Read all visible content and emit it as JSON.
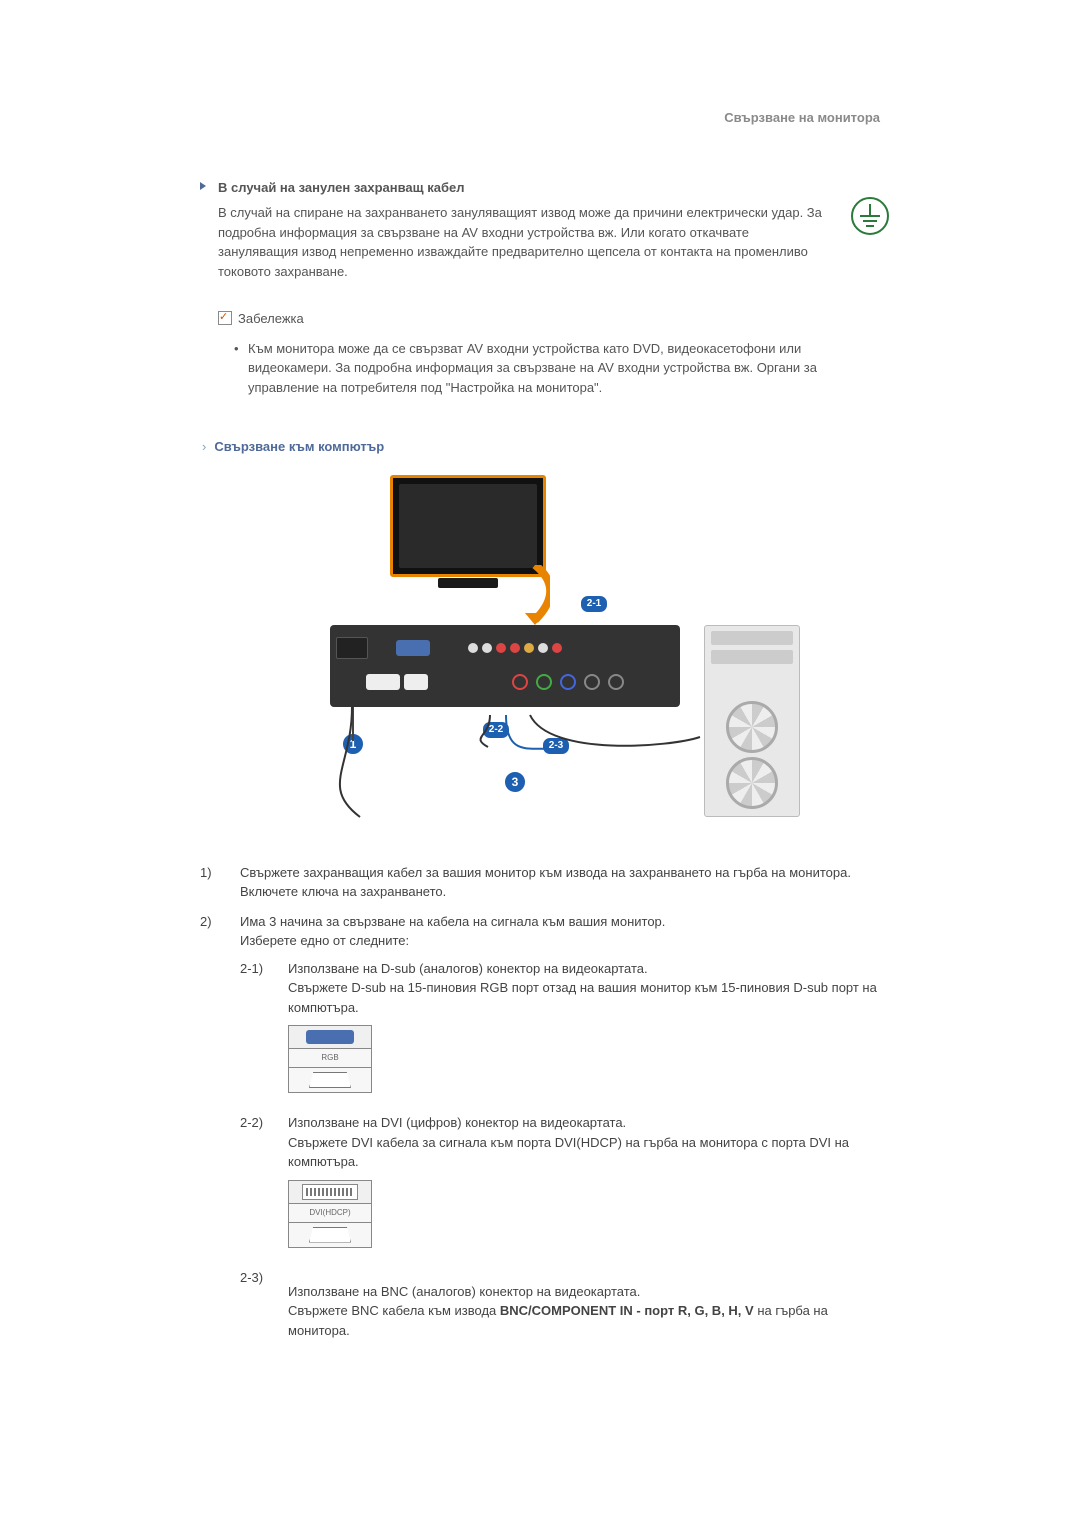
{
  "header": {
    "title": "Свързване на монитора"
  },
  "section1": {
    "title": "В случай на занулен захранващ кабел",
    "body": "В случай на спиране на захранването зануляващият извод може да причини електрически удар. За подробна информация за свързване на AV входни устройства вж. Или когато откачвате зануляващия извод непременно изваждайте предварително щепсела от контакта на променливо токовото захранване."
  },
  "note": {
    "label": "Забележка",
    "text": "Към монитора може да се свързват AV входни устройства като DVD, видеокасетофони или видеокамери. За подробна информация за свързване на AV входни устройства вж. Органи за управление на потребителя под \"Настройка на монитора\"."
  },
  "section2": {
    "title": "Свързване към компютър"
  },
  "diagram": {
    "callout_21": "2-1",
    "callout_22": "2-2",
    "callout_23": "2-3",
    "circle_1": "1",
    "circle_3": "3"
  },
  "steps": {
    "s1_num": "1)",
    "s1_text": "Свържете захранващия кабел за вашия монитор към извода на захранването на гърба на монитора. Включете ключа на захранването.",
    "s2_num": "2)",
    "s2_line1": "Има 3 начина за свързване на кабела на сигнала към вашия монитор.",
    "s2_line2": "Изберете едно от следните:",
    "sub21_num": "2-1)",
    "sub21_l1": "Използване на D-sub (аналогов) конектор на видеокартата.",
    "sub21_l2": "Свържете D-sub на 15-пиновия RGB порт отзад на вашия монитор към 15-пиновия D-sub порт на компютъра.",
    "sub22_num": "2-2)",
    "sub22_l1": "Използване на DVI (цифров) конектор на видеокартата.",
    "sub22_l2": "Свържете DVI кабела за сигнала към порта DVI(HDCP) на гърба на монитора с порта DVI на компютъра.",
    "sub23_num": "2-3)",
    "sub23_l1": "Използване на BNC (аналогов) конектор на видеокартата.",
    "sub23_l2a": "Свържете BNC кабела към извода ",
    "sub23_l2b": "BNC/COMPONENT IN - порт R, G, B, H, V",
    "sub23_l2c": " на гърба на монитора."
  },
  "port_labels": {
    "rgb": "RGB",
    "dvi": "DVI(HDCP)"
  }
}
